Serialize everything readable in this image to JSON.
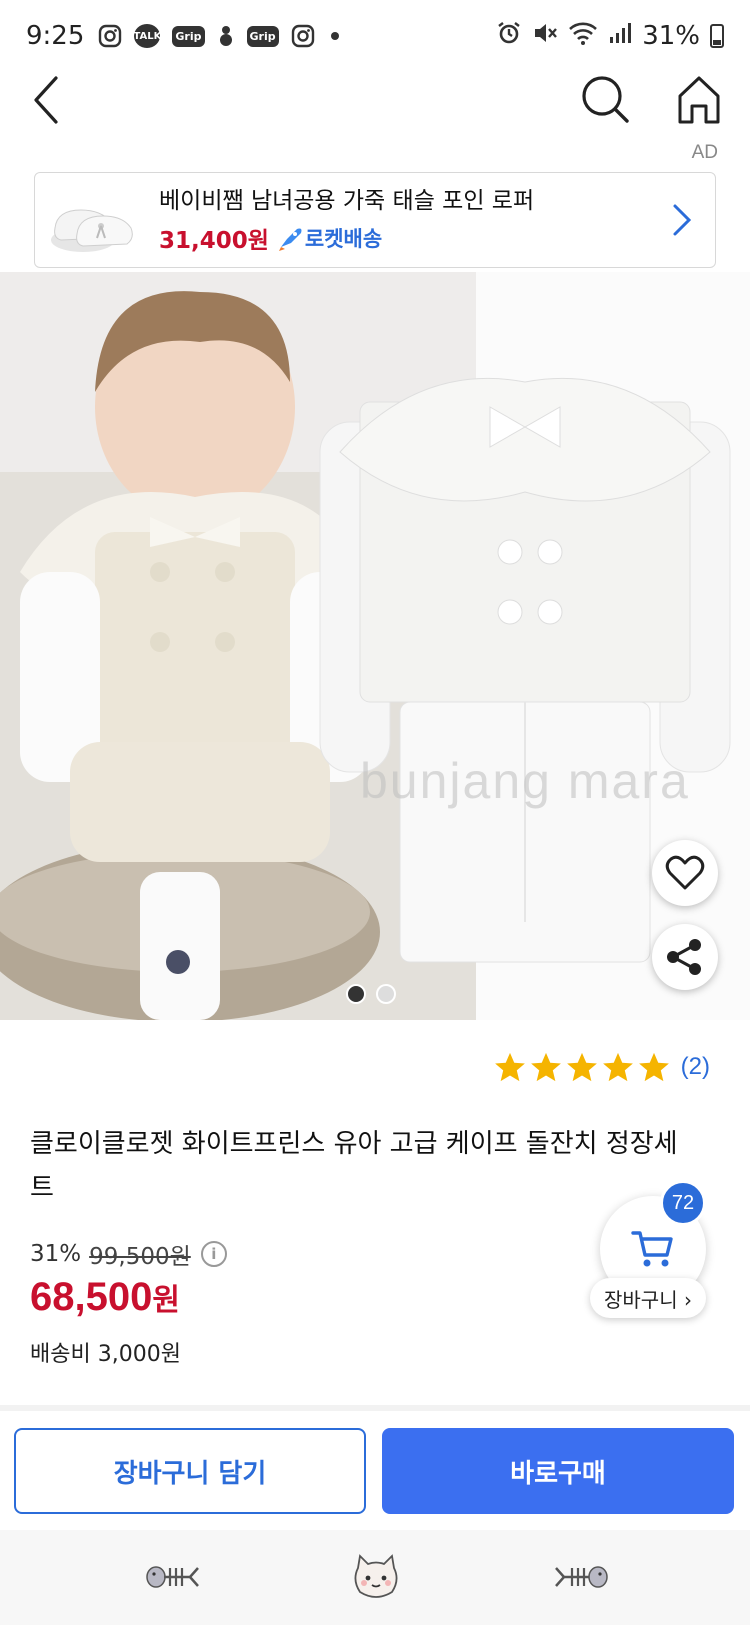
{
  "status_bar": {
    "time": "9:25",
    "app_icons": [
      "instagram-icon",
      "kakaotalk-icon",
      "grip-icon",
      "clover-icon",
      "grip-icon",
      "instagram-icon"
    ],
    "talk_label": "TALK",
    "grip_label": "Grip",
    "battery_percent": "31%"
  },
  "ad": {
    "label": "AD",
    "title": "베이비쨈 남녀공용 가죽 태슬 포인 로퍼",
    "price": "31,400원",
    "delivery": "로켓배송"
  },
  "product": {
    "watermark": "bunjang mara",
    "image_count": 2,
    "active_image": 1,
    "rating_stars": 5,
    "review_count": "(2)",
    "title": "클로이클로젯 화이트프린스 유아 고급 케이프 돌잔치 정장세트",
    "discount": "31%",
    "original_price": "99,500원",
    "price_number": "68,500",
    "price_unit": "원",
    "shipping": "배송비 3,000원"
  },
  "cart_fab": {
    "badge": "72",
    "label": "장바구니 ›"
  },
  "actions": {
    "add_to_cart": "장바구니 담기",
    "buy_now": "바로구매"
  },
  "colors": {
    "accent_blue": "#2b6cd9",
    "buy_blue": "#3b6ff0",
    "price_red": "#c8102e",
    "star_yellow": "#f5b400"
  }
}
